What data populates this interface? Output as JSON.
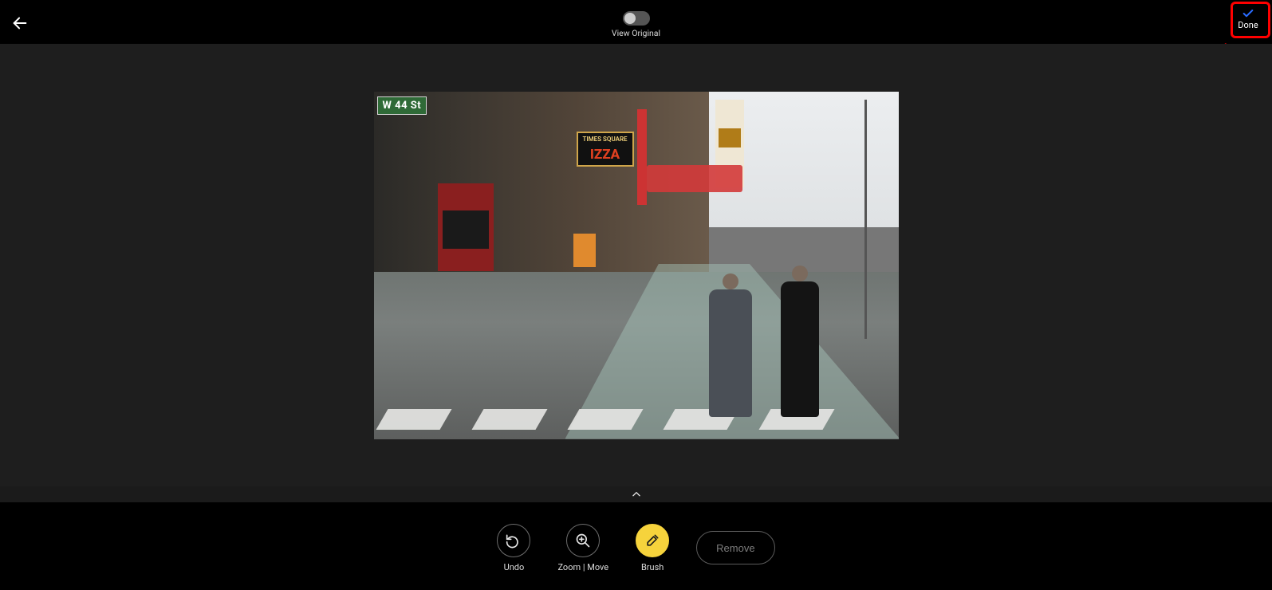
{
  "header": {
    "view_original_label": "View Original",
    "view_original_on": false,
    "done_label": "Done"
  },
  "scene": {
    "street_sign": "W 44 St",
    "pizza_sign_top": "TIMES SQUARE",
    "pizza_sign_main": "IZZA"
  },
  "toolbar": {
    "undo_label": "Undo",
    "zoom_label": "Zoom | Move",
    "brush_label": "Brush",
    "remove_label": "Remove",
    "active": "brush"
  },
  "annotation": {
    "target": "done-button"
  }
}
